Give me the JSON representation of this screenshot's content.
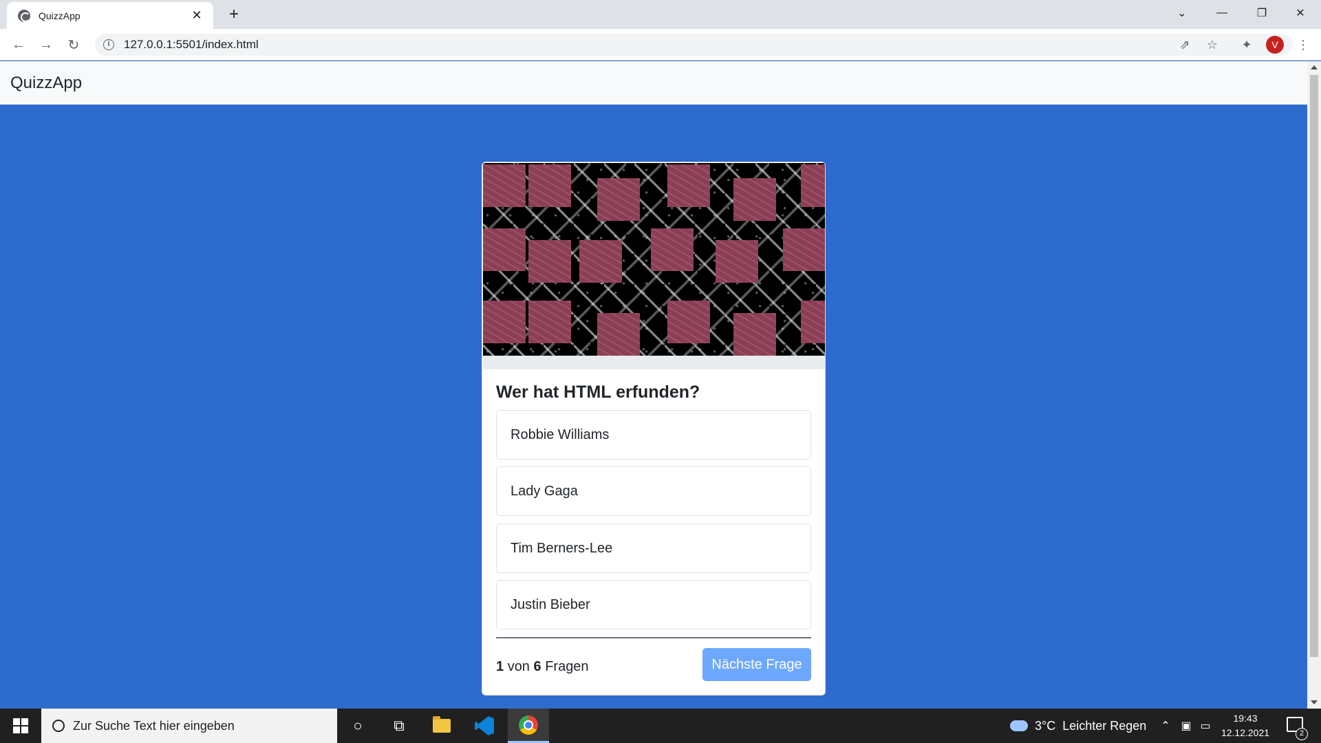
{
  "browser": {
    "tab_title": "QuizzApp",
    "tab_close": "✕",
    "new_tab": "+",
    "url": "127.0.0.1:5501/index.html",
    "profile_initial": "V"
  },
  "app": {
    "brand": "QuizzApp"
  },
  "quiz": {
    "question": "Wer hat HTML erfunden?",
    "answers": [
      "Robbie Williams",
      "Lady Gaga",
      "Tim Berners-Lee",
      "Justin Bieber"
    ],
    "current": "1",
    "of_label": "von",
    "total": "6",
    "questions_label": "Fragen",
    "next_label": "Nächste Frage"
  },
  "taskbar": {
    "search_placeholder": "Zur Suche Text hier eingeben",
    "weather": "3°C  Leichter Regen",
    "time": "19:43",
    "date": "12.12.2021",
    "notifications": "2"
  },
  "colors": {
    "page_background": "#2e6bcf",
    "button_background": "#6ea8fe",
    "image_tile": "#8c3e55"
  }
}
